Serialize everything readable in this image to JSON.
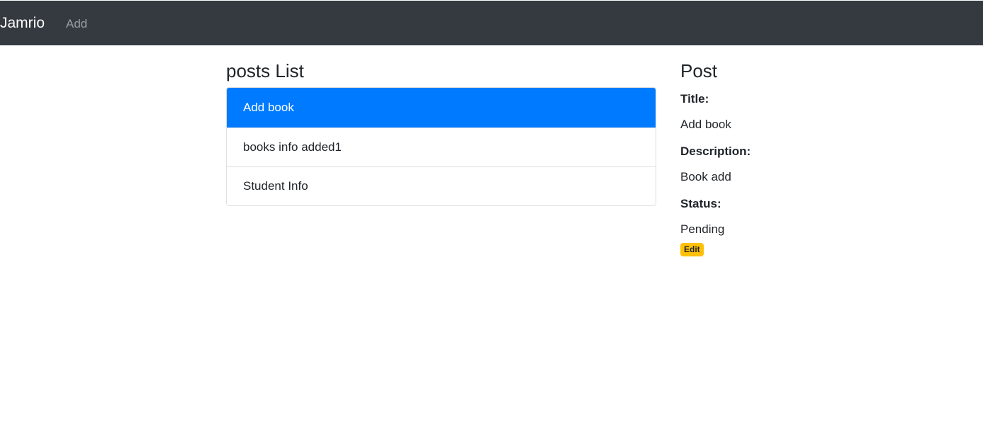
{
  "navbar": {
    "brand": "Jamrio",
    "links": [
      "Add"
    ]
  },
  "list": {
    "heading": "posts List",
    "items": [
      {
        "label": "Add book",
        "active": true
      },
      {
        "label": "books info added1",
        "active": false
      },
      {
        "label": "Student Info",
        "active": false
      }
    ]
  },
  "detail": {
    "heading": "Post",
    "title_label": "Title:",
    "title_value": "Add book",
    "description_label": "Description:",
    "description_value": "Book add",
    "status_label": "Status:",
    "status_value": "Pending",
    "edit_label": "Edit"
  },
  "colors": {
    "navbar_bg": "#343a40",
    "active_item": "#007bff",
    "edit_badge": "#ffc107"
  }
}
